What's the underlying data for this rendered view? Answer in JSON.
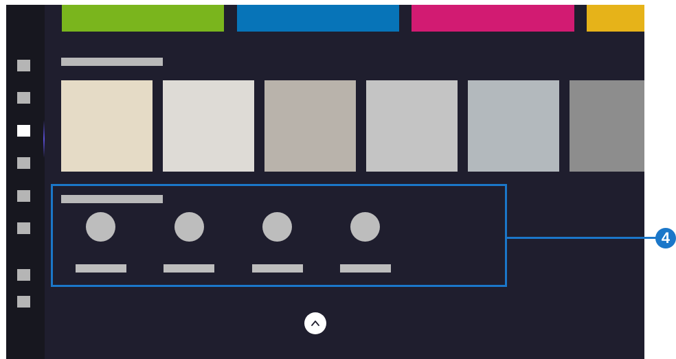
{
  "banners": [
    {
      "name": "green",
      "color": "#7ab51d"
    },
    {
      "name": "blue",
      "color": "#0774b8"
    },
    {
      "name": "magenta",
      "color": "#d21b72"
    },
    {
      "name": "yellow",
      "color": "#e6b319"
    }
  ],
  "sidebar": {
    "items": [
      {
        "icon": "menu-icon",
        "active": false
      },
      {
        "icon": "menu-icon",
        "active": false
      },
      {
        "icon": "menu-icon",
        "active": true
      },
      {
        "icon": "menu-icon",
        "active": false
      },
      {
        "icon": "menu-icon",
        "active": false
      },
      {
        "icon": "menu-icon",
        "active": false
      },
      {
        "icon": "menu-icon",
        "active": false
      },
      {
        "icon": "menu-icon",
        "active": false
      }
    ]
  },
  "swatches": [
    "#e5dbc6",
    "#dedbd6",
    "#b9b3ab",
    "#c4c4c4",
    "#b3b9bd",
    "#8d8d8d"
  ],
  "highlight": {
    "callout_number": "4",
    "color": "#1b77c9"
  },
  "colors": {
    "background": "#1f1e2e",
    "sidebar": "#17171f",
    "placeholder": "#bdbdbd"
  },
  "scroll_up": {
    "icon": "chevron-up-icon"
  }
}
